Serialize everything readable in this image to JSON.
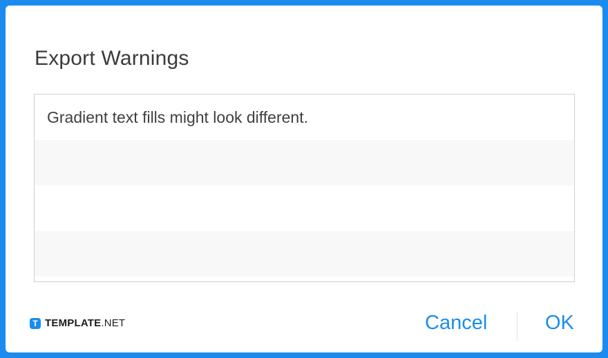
{
  "dialog": {
    "title": "Export Warnings",
    "warnings": [
      "Gradient text fills might look different.",
      "",
      "",
      ""
    ],
    "cancel_label": "Cancel",
    "ok_label": "OK"
  },
  "watermark": {
    "logo_letter": "T",
    "brand_bold": "TEMPLATE",
    "brand_suffix": ".NET"
  },
  "colors": {
    "accent": "#1a8cf0",
    "title_text": "#3b3b3b",
    "row_alt": "#f8f8f8"
  },
  "icons": {
    "brand_logo": "template-logo-icon"
  }
}
